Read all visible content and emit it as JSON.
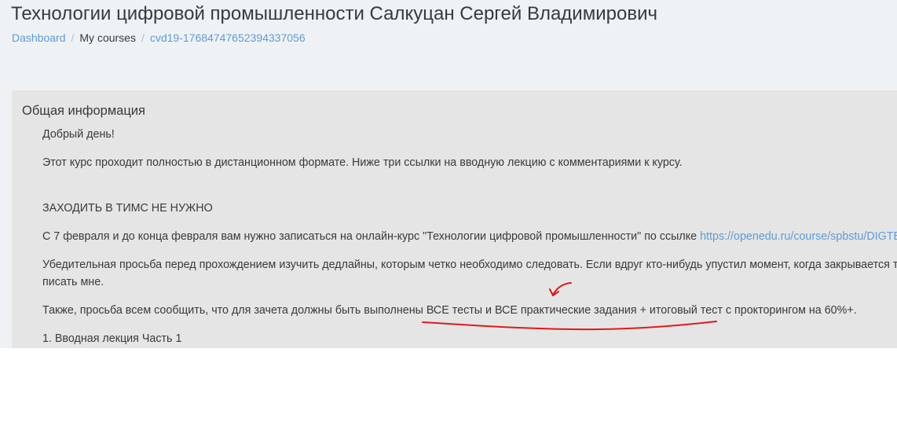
{
  "header": {
    "title": "Технологии цифровой промышленности Салкуцан Сергей Владимирович",
    "breadcrumb": [
      "Dashboard",
      "My courses",
      "cvd19-17684747652394337056"
    ]
  },
  "section": {
    "title": "Общая информация",
    "greeting": "Добрый день!",
    "intro": "Этот курс проходит полностью в дистанционном формате. Ниже три ссылки на вводную лекцию с комментариями к курсу.",
    "teams_notice": "ЗАХОДИТЬ В ТИМС НЕ НУЖНО",
    "enroll_text": "С 7 февраля и до конца февраля вам нужно записаться на онлайн-курс \"Технологии цифровой промышленности\" по ссылке ",
    "enroll_link": "https://openedu.ru/course/spbstu/DIGTEC",
    "deadline_line1": "Убедительная просьба перед прохождением изучить дедлайны, которым четко необходимо следовать. Если вдруг кто-нибудь упустил момент, когда закрывается т",
    "deadline_line2": "писать мне.",
    "requirement": "Также, просьба всем сообщить, что для зачета должны быть выполнены ВСЕ тесты и ВСЕ практические задания + итоговый тест с прокторингом на 60%+.",
    "lecture_1": "1. Вводная лекция Часть 1"
  },
  "annotation": {
    "color": "#e0191d"
  }
}
